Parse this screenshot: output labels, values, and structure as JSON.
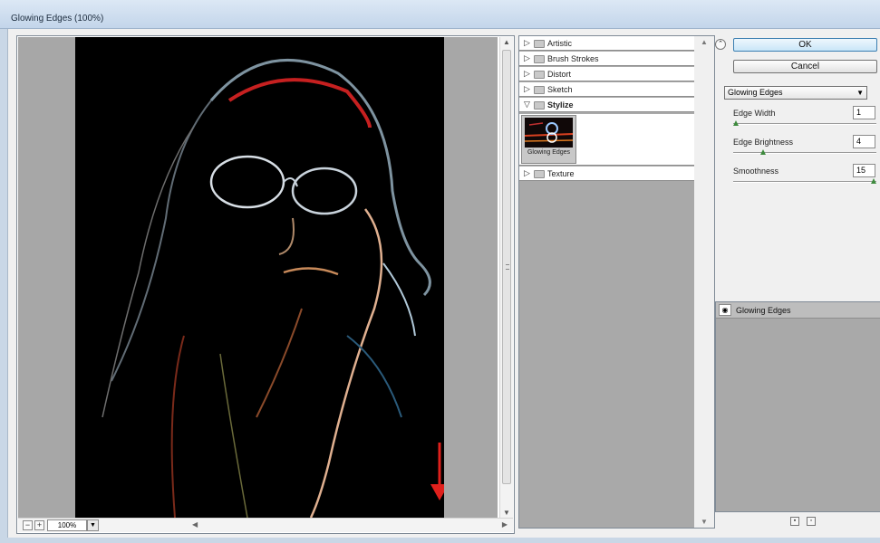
{
  "window": {
    "title": "Glowing Edges (100%)"
  },
  "preview": {
    "zoom_out": "−",
    "zoom_in": "+",
    "zoom_value": "100%"
  },
  "gallery": {
    "categories": [
      {
        "label": "Artistic",
        "expanded": false
      },
      {
        "label": "Brush Strokes",
        "expanded": false
      },
      {
        "label": "Distort",
        "expanded": false
      },
      {
        "label": "Sketch",
        "expanded": false
      },
      {
        "label": "Stylize",
        "expanded": true
      },
      {
        "label": "Texture",
        "expanded": false
      }
    ],
    "selected_thumbnail": "Glowing Edges"
  },
  "actions": {
    "ok_label": "OK",
    "cancel_label": "Cancel"
  },
  "filter_select": {
    "value": "Glowing Edges"
  },
  "params": [
    {
      "label": "Edge Width",
      "value": "1",
      "slider": 0.0
    },
    {
      "label": "Edge Brightness",
      "value": "4",
      "slider": 0.2
    },
    {
      "label": "Smoothness",
      "value": "15",
      "slider": 1.0
    }
  ],
  "layers": [
    {
      "label": "Glowing Edges",
      "visible": true
    }
  ],
  "colors": {
    "accent": "#3c7fb1",
    "slider_knob": "#3d8a3d",
    "annotation_arrow": "#e0201c"
  }
}
